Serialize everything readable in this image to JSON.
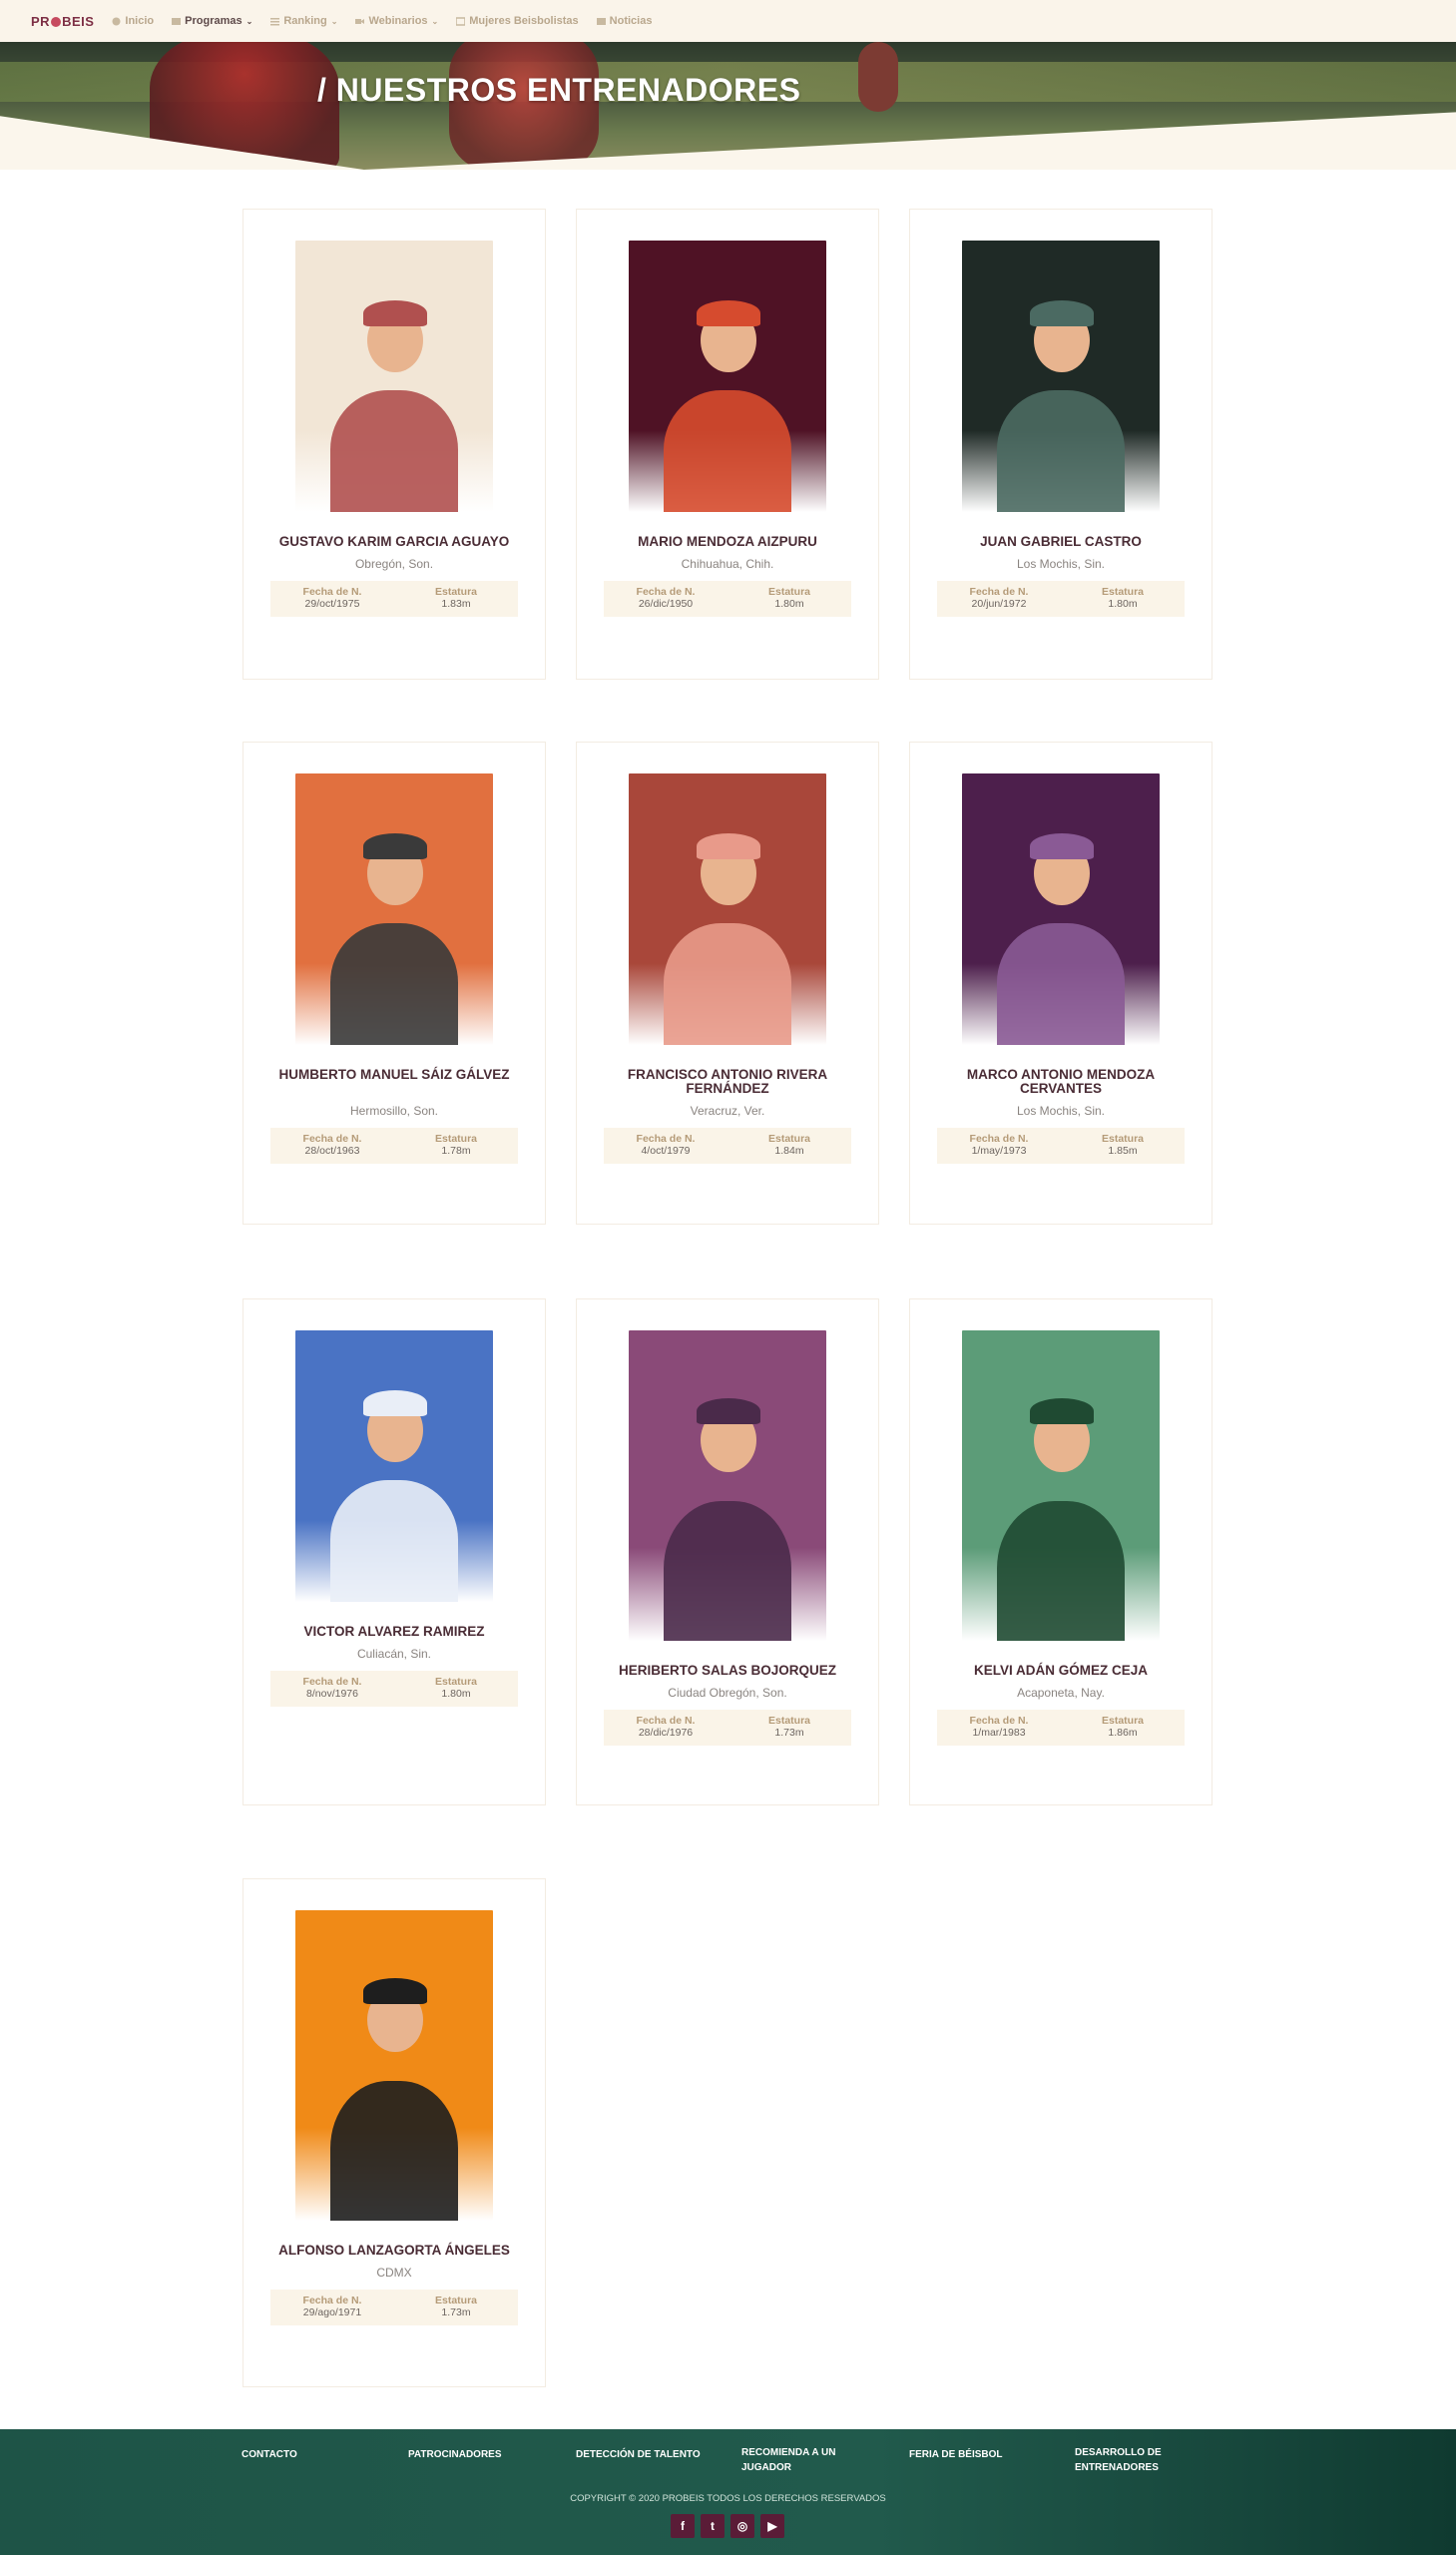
{
  "nav": {
    "logo": "PROBEIS",
    "items": [
      {
        "label": "Inicio"
      },
      {
        "label": "Programas"
      },
      {
        "label": "Ranking"
      },
      {
        "label": "Webinarios"
      },
      {
        "label": "Mujeres Beisbolistas"
      },
      {
        "label": "Noticias"
      }
    ],
    "accessibility_icon": "wheelchair-icon"
  },
  "hero": {
    "title": "/ NUESTROS ENTRENADORES"
  },
  "labels": {
    "birth": "Fecha de N.",
    "height": "Estatura"
  },
  "coaches": [
    {
      "name": "GUSTAVO KARIM GARCIA AGUAYO",
      "city": "Obregón, Son.",
      "birth": "29/oct/1975",
      "height": "1.83m",
      "bg": "#f2e6d6",
      "primary": "#b0504f"
    },
    {
      "name": "MARIO MENDOZA AIZPURU",
      "city": "Chihuahua, Chih.",
      "birth": "26/dic/1950",
      "height": "1.80m",
      "bg": "#4f1225",
      "primary": "#d64b2e"
    },
    {
      "name": "JUAN GABRIEL CASTRO",
      "city": "Los Mochis, Sin.",
      "birth": "20/jun/1972",
      "height": "1.80m",
      "bg": "#1f2a26",
      "primary": "#4b6a62"
    },
    {
      "name": "HUMBERTO MANUEL SÁIZ GÁLVEZ",
      "city": "Hermosillo, Son.",
      "birth": "28/oct/1963",
      "height": "1.78m",
      "bg": "#e1703f",
      "primary": "#3a3a3a"
    },
    {
      "name": "FRANCISCO ANTONIO RIVERA FERNÁNDEZ",
      "city": "Veracruz, Ver.",
      "birth": "4/oct/1979",
      "height": "1.84m",
      "bg": "#a9473a",
      "primary": "#e89a8a"
    },
    {
      "name": "MARCO ANTONIO MENDOZA CERVANTES",
      "city": "Los Mochis, Sin.",
      "birth": "1/may/1973",
      "height": "1.85m",
      "bg": "#4d1f4c",
      "primary": "#8a5a95"
    },
    {
      "name": "VICTOR ALVAREZ RAMIREZ",
      "city": "Culiacán, Sin.",
      "birth": "8/nov/1976",
      "height": "1.80m",
      "bg": "#4a73c4",
      "primary": "#e9eef7"
    },
    {
      "name": "HERIBERTO SALAS BOJORQUEZ",
      "city": "Ciudad Obregón, Son.",
      "birth": "28/dic/1976",
      "height": "1.73m",
      "bg": "#8a4a78",
      "primary": "#4a2a4a"
    },
    {
      "name": "KELVI ADÁN GÓMEZ CEJA",
      "city": "Acaponeta, Nay.",
      "birth": "1/mar/1983",
      "height": "1.86m",
      "bg": "#5c9c78",
      "primary": "#1f4a32"
    },
    {
      "name": "ALFONSO LANZAGORTA ÁNGELES",
      "city": "CDMX",
      "birth": "29/ago/1971",
      "height": "1.73m",
      "bg": "#f08a17",
      "primary": "#1e1e1e"
    }
  ],
  "footer": {
    "links": [
      {
        "label": "CONTACTO"
      },
      {
        "label": "PATROCINADORES"
      },
      {
        "label": "DETECCIÓN DE TALENTO"
      },
      {
        "label": "RECOMIENDA A UN JUGADOR"
      },
      {
        "label": "FERIA DE BÉISBOL"
      },
      {
        "label": "DESARROLLO DE ENTRENADORES"
      }
    ],
    "copyright": "COPYRIGHT © 2020 PROBEIS TODOS LOS DERECHOS RESERVADOS",
    "social": [
      {
        "icon": "facebook-icon",
        "glyph": "f"
      },
      {
        "icon": "twitter-icon",
        "glyph": "t"
      },
      {
        "icon": "instagram-icon",
        "glyph": "◎"
      },
      {
        "icon": "youtube-icon",
        "glyph": "▶"
      }
    ]
  }
}
